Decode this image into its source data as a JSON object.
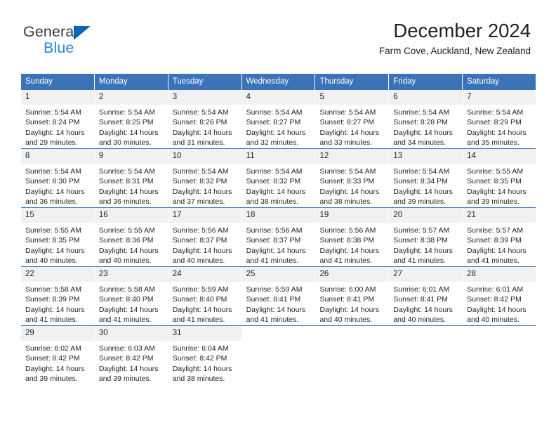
{
  "logo": {
    "word_one": "General",
    "word_two": "Blue",
    "triangle_color": "#0c66b1",
    "blue_text_color": "#2389d6"
  },
  "header": {
    "title": "December 2024",
    "subtitle": "Farm Cove, Auckland, New Zealand"
  },
  "theme": {
    "header_blue": "#3b72b8",
    "day_number_bg": "#f1f1f1",
    "text_color": "#231f20"
  },
  "weekdays": [
    "Sunday",
    "Monday",
    "Tuesday",
    "Wednesday",
    "Thursday",
    "Friday",
    "Saturday"
  ],
  "weeks": [
    [
      {
        "day": "1",
        "sunrise": "Sunrise: 5:54 AM",
        "sunset": "Sunset: 8:24 PM",
        "daylight_line1": "Daylight: 14 hours",
        "daylight_line2": "and 29 minutes."
      },
      {
        "day": "2",
        "sunrise": "Sunrise: 5:54 AM",
        "sunset": "Sunset: 8:25 PM",
        "daylight_line1": "Daylight: 14 hours",
        "daylight_line2": "and 30 minutes."
      },
      {
        "day": "3",
        "sunrise": "Sunrise: 5:54 AM",
        "sunset": "Sunset: 8:26 PM",
        "daylight_line1": "Daylight: 14 hours",
        "daylight_line2": "and 31 minutes."
      },
      {
        "day": "4",
        "sunrise": "Sunrise: 5:54 AM",
        "sunset": "Sunset: 8:27 PM",
        "daylight_line1": "Daylight: 14 hours",
        "daylight_line2": "and 32 minutes."
      },
      {
        "day": "5",
        "sunrise": "Sunrise: 5:54 AM",
        "sunset": "Sunset: 8:27 PM",
        "daylight_line1": "Daylight: 14 hours",
        "daylight_line2": "and 33 minutes."
      },
      {
        "day": "6",
        "sunrise": "Sunrise: 5:54 AM",
        "sunset": "Sunset: 8:28 PM",
        "daylight_line1": "Daylight: 14 hours",
        "daylight_line2": "and 34 minutes."
      },
      {
        "day": "7",
        "sunrise": "Sunrise: 5:54 AM",
        "sunset": "Sunset: 8:29 PM",
        "daylight_line1": "Daylight: 14 hours",
        "daylight_line2": "and 35 minutes."
      }
    ],
    [
      {
        "day": "8",
        "sunrise": "Sunrise: 5:54 AM",
        "sunset": "Sunset: 8:30 PM",
        "daylight_line1": "Daylight: 14 hours",
        "daylight_line2": "and 36 minutes."
      },
      {
        "day": "9",
        "sunrise": "Sunrise: 5:54 AM",
        "sunset": "Sunset: 8:31 PM",
        "daylight_line1": "Daylight: 14 hours",
        "daylight_line2": "and 36 minutes."
      },
      {
        "day": "10",
        "sunrise": "Sunrise: 5:54 AM",
        "sunset": "Sunset: 8:32 PM",
        "daylight_line1": "Daylight: 14 hours",
        "daylight_line2": "and 37 minutes."
      },
      {
        "day": "11",
        "sunrise": "Sunrise: 5:54 AM",
        "sunset": "Sunset: 8:32 PM",
        "daylight_line1": "Daylight: 14 hours",
        "daylight_line2": "and 38 minutes."
      },
      {
        "day": "12",
        "sunrise": "Sunrise: 5:54 AM",
        "sunset": "Sunset: 8:33 PM",
        "daylight_line1": "Daylight: 14 hours",
        "daylight_line2": "and 38 minutes."
      },
      {
        "day": "13",
        "sunrise": "Sunrise: 5:54 AM",
        "sunset": "Sunset: 8:34 PM",
        "daylight_line1": "Daylight: 14 hours",
        "daylight_line2": "and 39 minutes."
      },
      {
        "day": "14",
        "sunrise": "Sunrise: 5:55 AM",
        "sunset": "Sunset: 8:35 PM",
        "daylight_line1": "Daylight: 14 hours",
        "daylight_line2": "and 39 minutes."
      }
    ],
    [
      {
        "day": "15",
        "sunrise": "Sunrise: 5:55 AM",
        "sunset": "Sunset: 8:35 PM",
        "daylight_line1": "Daylight: 14 hours",
        "daylight_line2": "and 40 minutes."
      },
      {
        "day": "16",
        "sunrise": "Sunrise: 5:55 AM",
        "sunset": "Sunset: 8:36 PM",
        "daylight_line1": "Daylight: 14 hours",
        "daylight_line2": "and 40 minutes."
      },
      {
        "day": "17",
        "sunrise": "Sunrise: 5:56 AM",
        "sunset": "Sunset: 8:37 PM",
        "daylight_line1": "Daylight: 14 hours",
        "daylight_line2": "and 40 minutes."
      },
      {
        "day": "18",
        "sunrise": "Sunrise: 5:56 AM",
        "sunset": "Sunset: 8:37 PM",
        "daylight_line1": "Daylight: 14 hours",
        "daylight_line2": "and 41 minutes."
      },
      {
        "day": "19",
        "sunrise": "Sunrise: 5:56 AM",
        "sunset": "Sunset: 8:38 PM",
        "daylight_line1": "Daylight: 14 hours",
        "daylight_line2": "and 41 minutes."
      },
      {
        "day": "20",
        "sunrise": "Sunrise: 5:57 AM",
        "sunset": "Sunset: 8:38 PM",
        "daylight_line1": "Daylight: 14 hours",
        "daylight_line2": "and 41 minutes."
      },
      {
        "day": "21",
        "sunrise": "Sunrise: 5:57 AM",
        "sunset": "Sunset: 8:39 PM",
        "daylight_line1": "Daylight: 14 hours",
        "daylight_line2": "and 41 minutes."
      }
    ],
    [
      {
        "day": "22",
        "sunrise": "Sunrise: 5:58 AM",
        "sunset": "Sunset: 8:39 PM",
        "daylight_line1": "Daylight: 14 hours",
        "daylight_line2": "and 41 minutes."
      },
      {
        "day": "23",
        "sunrise": "Sunrise: 5:58 AM",
        "sunset": "Sunset: 8:40 PM",
        "daylight_line1": "Daylight: 14 hours",
        "daylight_line2": "and 41 minutes."
      },
      {
        "day": "24",
        "sunrise": "Sunrise: 5:59 AM",
        "sunset": "Sunset: 8:40 PM",
        "daylight_line1": "Daylight: 14 hours",
        "daylight_line2": "and 41 minutes."
      },
      {
        "day": "25",
        "sunrise": "Sunrise: 5:59 AM",
        "sunset": "Sunset: 8:41 PM",
        "daylight_line1": "Daylight: 14 hours",
        "daylight_line2": "and 41 minutes."
      },
      {
        "day": "26",
        "sunrise": "Sunrise: 6:00 AM",
        "sunset": "Sunset: 8:41 PM",
        "daylight_line1": "Daylight: 14 hours",
        "daylight_line2": "and 40 minutes."
      },
      {
        "day": "27",
        "sunrise": "Sunrise: 6:01 AM",
        "sunset": "Sunset: 8:41 PM",
        "daylight_line1": "Daylight: 14 hours",
        "daylight_line2": "and 40 minutes."
      },
      {
        "day": "28",
        "sunrise": "Sunrise: 6:01 AM",
        "sunset": "Sunset: 8:42 PM",
        "daylight_line1": "Daylight: 14 hours",
        "daylight_line2": "and 40 minutes."
      }
    ],
    [
      {
        "day": "29",
        "sunrise": "Sunrise: 6:02 AM",
        "sunset": "Sunset: 8:42 PM",
        "daylight_line1": "Daylight: 14 hours",
        "daylight_line2": "and 39 minutes."
      },
      {
        "day": "30",
        "sunrise": "Sunrise: 6:03 AM",
        "sunset": "Sunset: 8:42 PM",
        "daylight_line1": "Daylight: 14 hours",
        "daylight_line2": "and 39 minutes."
      },
      {
        "day": "31",
        "sunrise": "Sunrise: 6:04 AM",
        "sunset": "Sunset: 8:42 PM",
        "daylight_line1": "Daylight: 14 hours",
        "daylight_line2": "and 38 minutes."
      },
      {
        "day": "",
        "sunrise": "",
        "sunset": "",
        "daylight_line1": "",
        "daylight_line2": ""
      },
      {
        "day": "",
        "sunrise": "",
        "sunset": "",
        "daylight_line1": "",
        "daylight_line2": ""
      },
      {
        "day": "",
        "sunrise": "",
        "sunset": "",
        "daylight_line1": "",
        "daylight_line2": ""
      },
      {
        "day": "",
        "sunrise": "",
        "sunset": "",
        "daylight_line1": "",
        "daylight_line2": ""
      }
    ]
  ]
}
